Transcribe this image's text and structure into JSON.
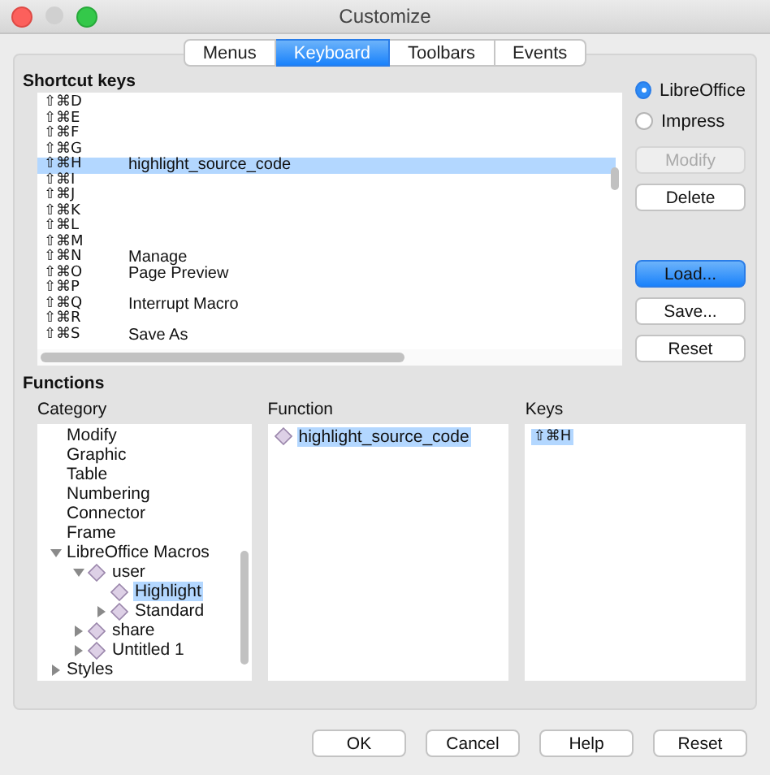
{
  "window": {
    "title": "Customize"
  },
  "tabs": [
    {
      "label": "Menus",
      "selected": false
    },
    {
      "label": "Keyboard",
      "selected": true
    },
    {
      "label": "Toolbars",
      "selected": false
    },
    {
      "label": "Events",
      "selected": false
    }
  ],
  "shortcut_keys": {
    "title": "Shortcut keys",
    "rows": [
      {
        "key": "⇧⌘D",
        "command": "",
        "selected": false
      },
      {
        "key": "⇧⌘E",
        "command": "",
        "selected": false
      },
      {
        "key": "⇧⌘F",
        "command": "",
        "selected": false
      },
      {
        "key": "⇧⌘G",
        "command": "",
        "selected": false
      },
      {
        "key": "⇧⌘H",
        "command": "highlight_source_code",
        "selected": true
      },
      {
        "key": "⇧⌘I",
        "command": "",
        "selected": false
      },
      {
        "key": "⇧⌘J",
        "command": "",
        "selected": false
      },
      {
        "key": "⇧⌘K",
        "command": "",
        "selected": false
      },
      {
        "key": "⇧⌘L",
        "command": "",
        "selected": false
      },
      {
        "key": "⇧⌘M",
        "command": "",
        "selected": false
      },
      {
        "key": "⇧⌘N",
        "command": "Manage",
        "selected": false
      },
      {
        "key": "⇧⌘O",
        "command": "Page Preview",
        "selected": false
      },
      {
        "key": "⇧⌘P",
        "command": "",
        "selected": false
      },
      {
        "key": "⇧⌘Q",
        "command": "Interrupt Macro",
        "selected": false
      },
      {
        "key": "⇧⌘R",
        "command": "",
        "selected": false
      },
      {
        "key": "⇧⌘S",
        "command": "Save As",
        "selected": false
      }
    ]
  },
  "scope": [
    {
      "label": "LibreOffice",
      "selected": true
    },
    {
      "label": "Impress",
      "selected": false
    }
  ],
  "side_buttons": [
    [
      {
        "label": "Modify",
        "disabled": true,
        "default": false
      },
      {
        "label": "Delete",
        "disabled": false,
        "default": false
      }
    ],
    [
      {
        "label": "Load...",
        "disabled": false,
        "default": true
      },
      {
        "label": "Save...",
        "disabled": false,
        "default": false
      },
      {
        "label": "Reset",
        "disabled": false,
        "default": false
      }
    ]
  ],
  "functions": {
    "title": "Functions",
    "category": {
      "label": "Category",
      "items": [
        {
          "label": "Modify",
          "kind": "plain",
          "selected": false
        },
        {
          "label": "Graphic",
          "kind": "plain",
          "selected": false
        },
        {
          "label": "Table",
          "kind": "plain",
          "selected": false
        },
        {
          "label": "Numbering",
          "kind": "plain",
          "selected": false
        },
        {
          "label": "Connector",
          "kind": "plain",
          "selected": false
        },
        {
          "label": "Frame",
          "kind": "plain",
          "selected": false
        },
        {
          "label": "LibreOffice Macros",
          "kind": "group",
          "expanded": true,
          "selected": false,
          "children": [
            {
              "label": "user",
              "kind": "library",
              "expanded": true,
              "selected": false,
              "children": [
                {
                  "label": "Highlight",
                  "kind": "module",
                  "selected": true
                },
                {
                  "label": "Standard",
                  "kind": "library",
                  "expanded": false,
                  "selected": false
                }
              ]
            },
            {
              "label": "share",
              "kind": "library",
              "expanded": false,
              "selected": false
            },
            {
              "label": "Untitled 1",
              "kind": "library",
              "expanded": false,
              "selected": false
            }
          ]
        },
        {
          "label": "Styles",
          "kind": "group",
          "expanded": false,
          "selected": false
        }
      ]
    },
    "function": {
      "label": "Function",
      "items": [
        {
          "label": "highlight_source_code",
          "selected": true
        }
      ]
    },
    "keys": {
      "label": "Keys",
      "items": [
        {
          "label": "⇧⌘H",
          "selected": true
        }
      ]
    }
  },
  "buttons": [
    {
      "label": "OK"
    },
    {
      "label": "Cancel"
    },
    {
      "label": "Help"
    },
    {
      "label": "Reset"
    }
  ]
}
